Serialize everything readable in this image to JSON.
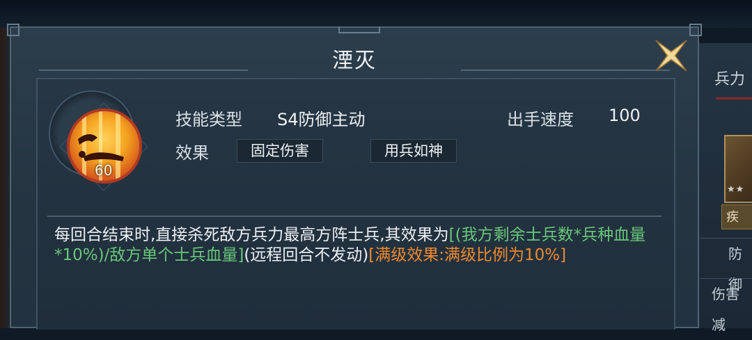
{
  "dialog": {
    "title": "湮灭",
    "close_icon": "close-x-icon"
  },
  "skill": {
    "icon": "skill-annihilate-icon",
    "level": "60",
    "type_label": "技能类型",
    "type_value": "S4防御主动",
    "speed_label": "出手速度",
    "speed_value": "100",
    "effect_label": "效果",
    "effect_tags": [
      "固定伤害",
      "用兵如神"
    ],
    "description": {
      "part1": "每回合结束时,直接杀死敌方兵力最高方阵士兵,其效果为",
      "part2": "[(我方剩余士兵数*兵种血量*10%)/敌方单个士兵血量]",
      "part3": "(远程回合不发动)",
      "part4": "[满级效果:满级比例为10%]"
    }
  },
  "side_panel": {
    "tab": "兵力",
    "stars": "★★",
    "button": "疾",
    "row1": "防御",
    "row2": "伤害减"
  },
  "colors": {
    "accent_green": "#69c77a",
    "accent_orange": "#ef8a2c",
    "close_gold": "#d8b76e"
  }
}
